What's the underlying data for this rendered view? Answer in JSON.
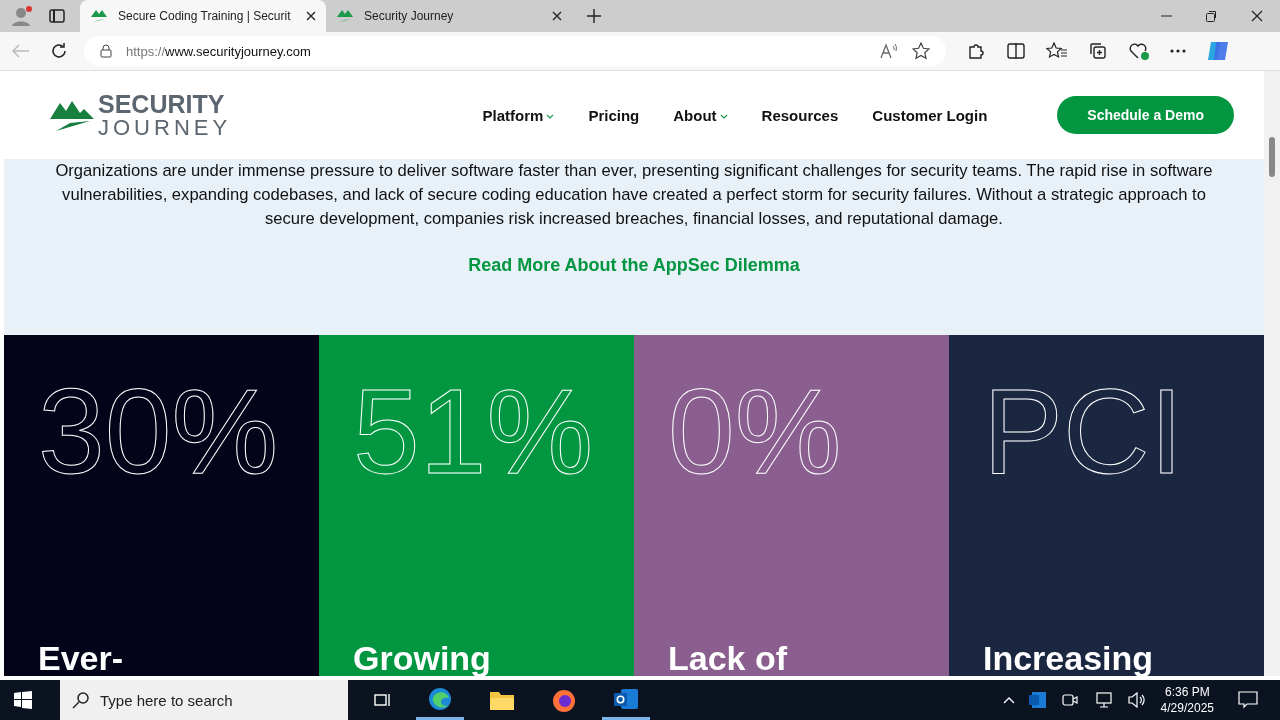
{
  "browser": {
    "tabs": [
      {
        "title": "Secure Coding Training | Securit",
        "selected": true
      },
      {
        "title": "Security Journey",
        "selected": false
      }
    ],
    "url_prefix": "https://",
    "url_host": "www.securityjourney.com"
  },
  "site": {
    "logo_top": "SECURITY",
    "logo_bottom": "JOURNEY",
    "nav": [
      {
        "label": "Platform",
        "dropdown": true
      },
      {
        "label": "Pricing",
        "dropdown": false
      },
      {
        "label": "About",
        "dropdown": true
      },
      {
        "label": "Resources",
        "dropdown": false
      },
      {
        "label": "Customer Login",
        "dropdown": false
      }
    ],
    "cta": "Schedule a Demo"
  },
  "intro": {
    "text": "Organizations are under immense pressure to deliver software faster than ever, presenting significant challenges for security teams. The rapid rise in software vulnerabilities, expanding codebases, and lack of secure coding education have created a perfect storm for security failures. Without a strategic approach to secure development, companies risk increased breaches, financial losses, and reputational damage.",
    "link": "Read More About the AppSec Dilemma"
  },
  "stats": [
    {
      "figure": "30%",
      "title": "Ever-",
      "color": "#03041a"
    },
    {
      "figure": "51%",
      "title": "Growing",
      "color": "#029640"
    },
    {
      "figure": "0%",
      "title": "Lack of",
      "color": "#8a5f8f"
    },
    {
      "figure": "PCI",
      "title": "Increasing",
      "color": "#1b2640"
    }
  ],
  "taskbar": {
    "search_placeholder": "Type here to search",
    "time": "6:36 PM",
    "date": "4/29/2025"
  }
}
